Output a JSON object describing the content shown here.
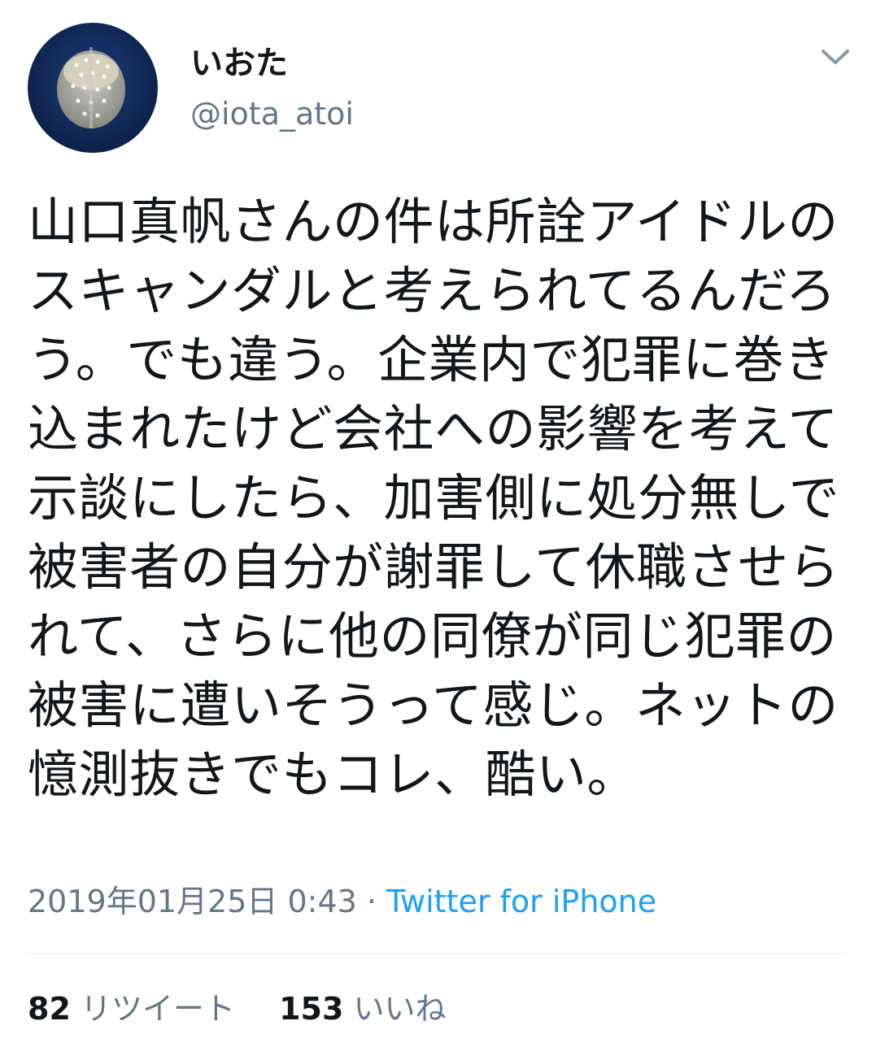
{
  "colors": {
    "text": "#14171a",
    "secondary": "#657786",
    "link": "#1da1f2",
    "divider": "#e1e8ed"
  },
  "user": {
    "display_name": "いおた",
    "handle": "@iota_atoi",
    "avatar_icon": "jellyfish-avatar"
  },
  "menu": {
    "icon": "chevron-down-icon"
  },
  "tweet": {
    "text": "山口真帆さんの件は所詮アイドルのスキャンダルと考えられてるんだろう。でも違う。企業内で犯罪に巻き込まれたけど会社への影響を考えて示談にしたら、加害側に処分無しで被害者の自分が謝罪して休職させられて、さらに他の同僚が同じ犯罪の被害に遭いそうって感じ。ネットの憶測抜きでもコレ、酷い。",
    "timestamp": "2019年01月25日 0:43",
    "separator": "·",
    "source": "Twitter for iPhone"
  },
  "stats": {
    "retweets_count": "82",
    "retweets_label": "リツイート",
    "likes_count": "153",
    "likes_label": "いいね"
  }
}
